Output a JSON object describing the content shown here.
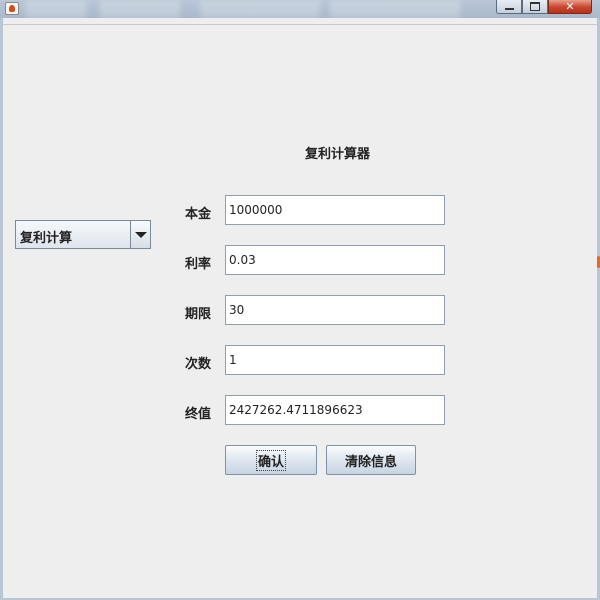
{
  "window": {
    "close_glyph": "✕"
  },
  "calculator": {
    "title": "复利计算器",
    "mode_selected": "复利计算",
    "fields": {
      "principal": {
        "label": "本金",
        "value": "1000000"
      },
      "rate": {
        "label": "利率",
        "value": "0.03"
      },
      "term": {
        "label": "期限",
        "value": "30"
      },
      "times": {
        "label": "次数",
        "value": "1"
      },
      "final_value": {
        "label": "终值",
        "value": "2427262.4711896623"
      }
    },
    "buttons": {
      "confirm": "确认",
      "clear": "清除信息"
    }
  },
  "colors": {
    "panel_bg": "#eeeeee",
    "close_button": "#c9452d",
    "frame": "#b8c7d8"
  },
  "icons": {
    "app": "java-cup-icon",
    "combo_arrow": "chevron-down-icon"
  }
}
